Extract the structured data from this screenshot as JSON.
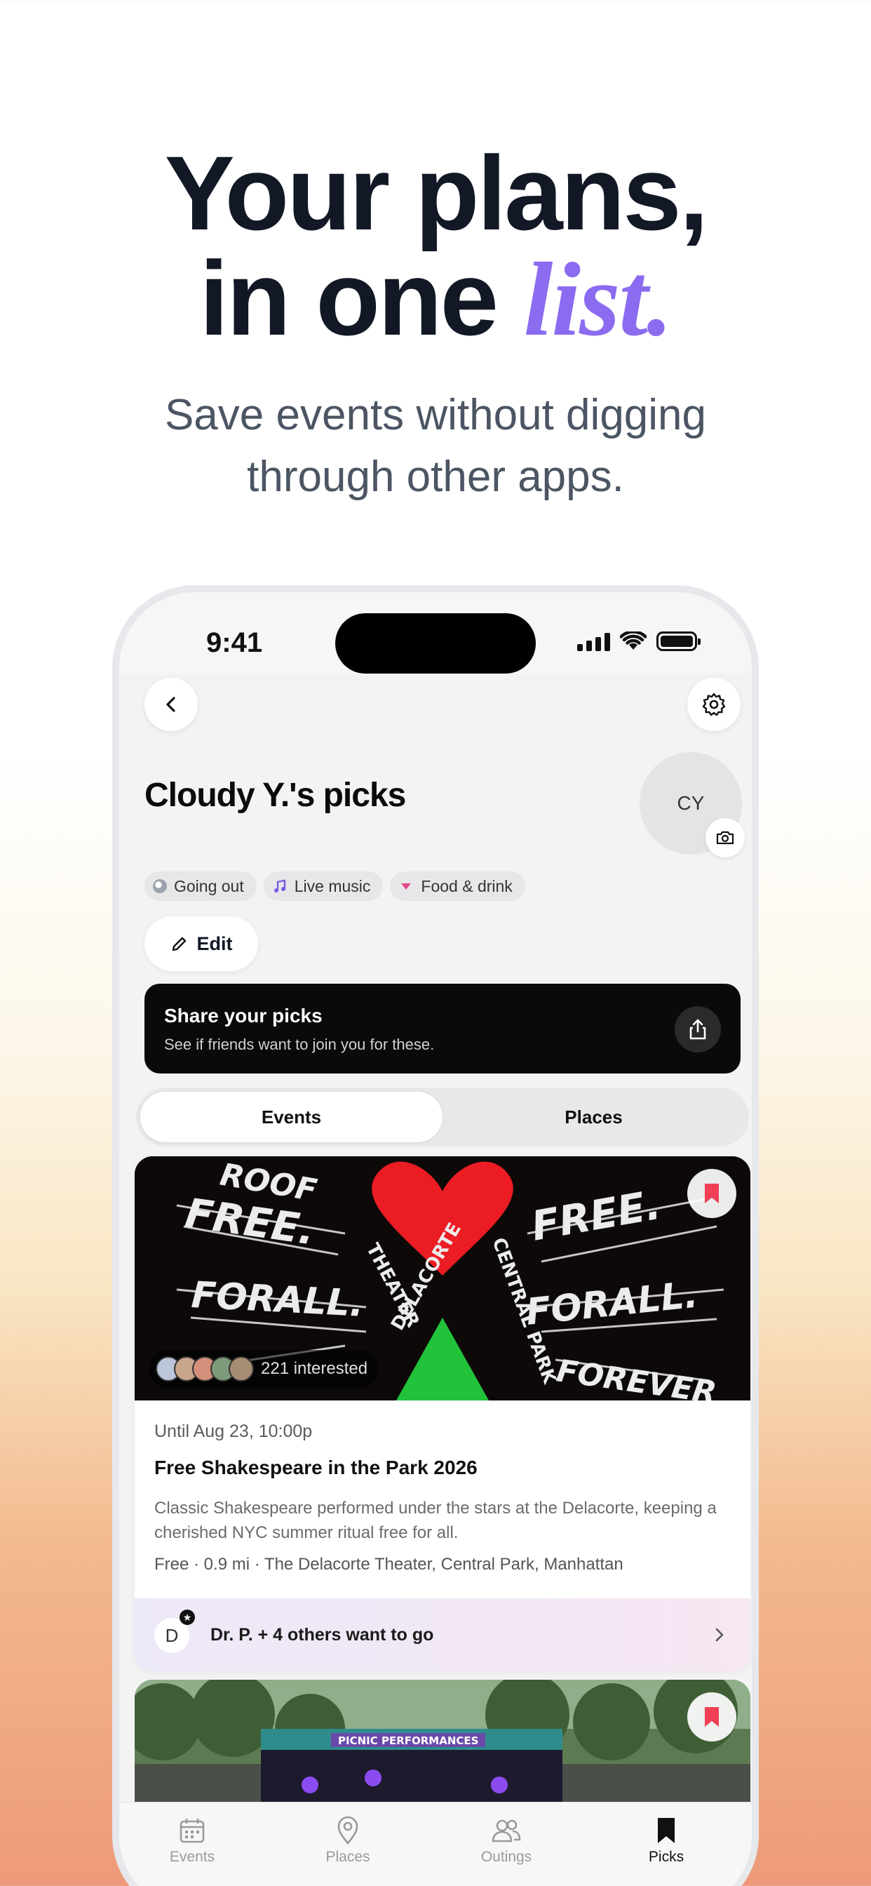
{
  "hero": {
    "line1": "Your plans,",
    "line2_prefix": "in one ",
    "line2_accent": "list.",
    "subtitle_line1": "Save events without digging",
    "subtitle_line2": "through other apps."
  },
  "status_bar": {
    "time": "9:41"
  },
  "profile": {
    "title": "Cloudy Y.'s picks",
    "avatar_initials": "CY",
    "chips": [
      {
        "label": "Going out",
        "color": "#9ca3af"
      },
      {
        "label": "Live music",
        "color": "#8b6cf0"
      },
      {
        "label": "Food & drink",
        "color": "#e24a8d"
      }
    ],
    "edit_label": "Edit"
  },
  "share": {
    "title": "Share your picks",
    "subtitle": "See if friends want to join you for these."
  },
  "segments": {
    "events": "Events",
    "places": "Places",
    "active": "events"
  },
  "event_card": {
    "interested": "221 interested",
    "date": "Until Aug 23, 10:00p",
    "title": "Free Shakespeare in the Park 2026",
    "description": "Classic Shakespeare performed under the stars at the Delacorte, keeping a cherished NYC summer ritual free for all.",
    "meta": "Free · 0.9 mi · The Delacorte Theater, Central Park, Manhattan",
    "friend_initial": "D",
    "friends_text": "Dr. P. + 4 others want to go",
    "bookmarked": true
  },
  "second_card": {
    "sign_text": "PICNIC PERFORMANCES",
    "bookmarked": true
  },
  "tabbar": {
    "items": [
      {
        "label": "Events",
        "icon": "calendar-icon"
      },
      {
        "label": "Places",
        "icon": "map-pin-icon"
      },
      {
        "label": "Outings",
        "icon": "people-icon"
      },
      {
        "label": "Picks",
        "icon": "bookmark-icon"
      }
    ],
    "active": "Picks"
  },
  "colors": {
    "accent": "#8b6cf0",
    "bookmark_red": "#ef4056"
  }
}
